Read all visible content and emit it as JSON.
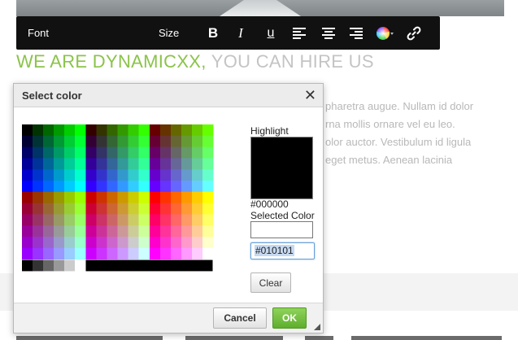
{
  "toolbar": {
    "font_label": "Font",
    "size_label": "Size",
    "bold_label": "B",
    "italic_label": "I",
    "underline_label": "u",
    "icons": [
      "bold-icon",
      "italic-icon",
      "underline-icon",
      "align-left-icon",
      "align-center-icon",
      "align-right-icon",
      "text-color-icon",
      "link-icon"
    ]
  },
  "page": {
    "heading_accent": "WE ARE DYNAMICXX,",
    "heading_rest": " YOU CAN HIRE US",
    "accent_color": "#8bc34a",
    "body_lines": [
      "pharetra augue. Nullam id dolor",
      "rna mollis ornare vel eu leo.",
      "olor auctor. Vestibulum id ligula",
      "eget metus. Aenean lacinia"
    ]
  },
  "dialog": {
    "title": "Select color",
    "highlight_label": "Highlight",
    "highlight_color": "#000000",
    "highlight_hex": "#000000",
    "selected_label": "Selected Color",
    "selected_color": "#ffffff",
    "hex_input_value": "#010101",
    "clear_label": "Clear",
    "cancel_label": "Cancel",
    "ok_label": "OK"
  }
}
